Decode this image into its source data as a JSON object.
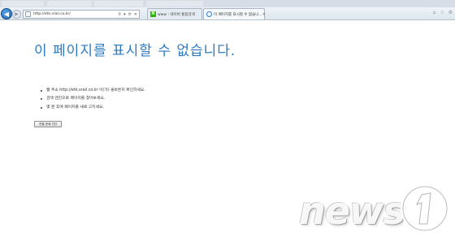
{
  "browser": {
    "address": "http://etk.srail.co.kr/",
    "back_icon": "back-arrow-icon",
    "forward_icon": "forward-arrow-icon",
    "tabs": [
      {
        "label": "www : 네이버 통합검색",
        "icon": "naver-icon"
      },
      {
        "label": "이 페이지를 표시할 수 없습니...",
        "icon": "ie-icon"
      }
    ]
  },
  "error_page": {
    "title": "이 페이지를 표시할 수 없습니다.",
    "bullets": [
      "웹 주소 http://etk.srail.co.kr 이(가) 올바른지 확인하세요.",
      "검색 엔진으로 페이지를 찾아보세요.",
      "몇 분 후에 페이지를 새로 고치세요."
    ],
    "diagnose_button": "연결 문제 진단",
    "title_color": "#2b7ac0"
  },
  "watermark": {
    "logo": "news1",
    "text": "news",
    "mark": "1"
  }
}
